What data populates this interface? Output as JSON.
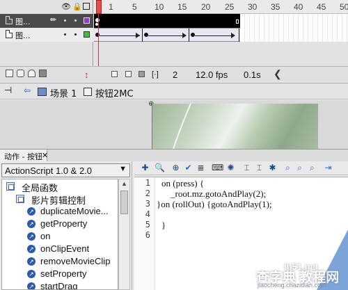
{
  "timeline": {
    "frame_numbers": [
      "1",
      "5",
      "10",
      "15",
      "20",
      "25",
      "30",
      "35",
      "40",
      "45",
      "50"
    ],
    "layers": [
      {
        "name": "图..."
      },
      {
        "name": "图..."
      }
    ],
    "current_frame": "2",
    "fps": "12.0 fps",
    "elapsed": "0.1s"
  },
  "breadcrumb": {
    "scene": "场景 1",
    "symbol": "按钮2MC"
  },
  "actions_panel": {
    "tab_label": "动作 - 按钮",
    "version_select": "ActionScript 1.0 & 2.0",
    "tree": [
      {
        "label": "全局函数",
        "level": 0,
        "kind": "book"
      },
      {
        "label": "影片剪辑控制",
        "level": 1,
        "kind": "book"
      },
      {
        "label": "duplicateMovie...",
        "level": 2,
        "kind": "action"
      },
      {
        "label": "getProperty",
        "level": 2,
        "kind": "action"
      },
      {
        "label": "on",
        "level": 2,
        "kind": "action"
      },
      {
        "label": "onClipEvent",
        "level": 2,
        "kind": "action"
      },
      {
        "label": "removeMovieClip",
        "level": 2,
        "kind": "action"
      },
      {
        "label": "setProperty",
        "level": 2,
        "kind": "action"
      },
      {
        "label": "startDrag",
        "level": 2,
        "kind": "action"
      }
    ],
    "code_lines": [
      {
        "n": "1",
        "text": "on (press) {"
      },
      {
        "n": "2",
        "text": "    _root.mz.gotoAndPlay(2);"
      },
      {
        "n": "3",
        "text": "}on (rollOut) {gotoAndPlay(1);"
      },
      {
        "n": "4",
        "text": ""
      },
      {
        "n": "5",
        "text": "}"
      },
      {
        "n": "6",
        "text": ""
      }
    ]
  },
  "watermark": {
    "top": "ib51.net",
    "main": "查字典 教程网",
    "url": "jiaocheng.chazidian.com"
  },
  "colors": {
    "playhead": "#e03030",
    "layer_selected": "#4a4a4a",
    "layer1_swatch": "#8b3fd0",
    "layer2_swatch": "#3fbf3f"
  }
}
